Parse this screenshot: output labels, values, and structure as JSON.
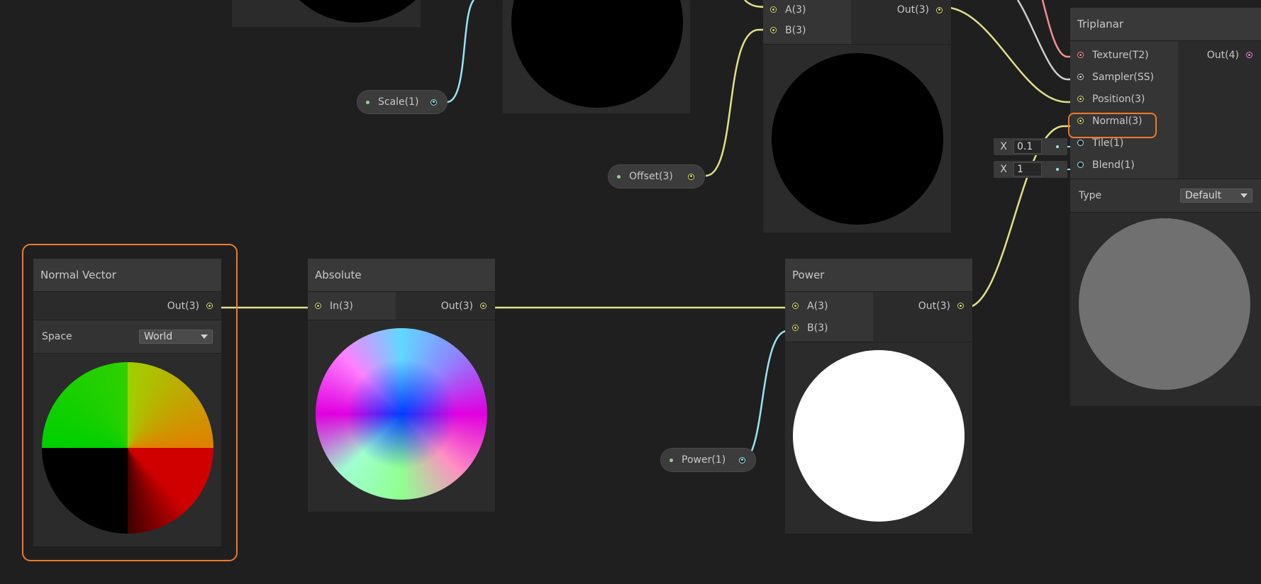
{
  "colors": {
    "wire_vector": "#d8d870",
    "wire_float": "#9ae3f2",
    "wire_texture": "#f09090",
    "wire_sampler": "#cfcfcf",
    "highlight": "#ee7a2b"
  },
  "nodes": {
    "normal_vector": {
      "title": "Normal Vector",
      "out": "Out(3)",
      "space_label": "Space",
      "space_value": "World"
    },
    "absolute": {
      "title": "Absolute",
      "in": "In(3)",
      "out": "Out(3)"
    },
    "power": {
      "title": "Power",
      "a": "A(3)",
      "b": "B(3)",
      "out": "Out(3)"
    },
    "add": {
      "a": "A(3)",
      "b": "B(3)",
      "out": "Out(3)"
    },
    "triplanar": {
      "title": "Triplanar",
      "texture": "Texture(T2)",
      "sampler": "Sampler(SS)",
      "position": "Position(3)",
      "normal": "Normal(3)",
      "tile": "Tile(1)",
      "blend": "Blend(1)",
      "out": "Out(4)",
      "type_label": "Type",
      "type_value": "Default"
    }
  },
  "properties": {
    "scale": "Scale(1)",
    "offset": "Offset(3)",
    "power": "Power(1)"
  },
  "inline_inputs": {
    "tile_axis": "X",
    "tile_value": "0.1",
    "blend_axis": "X",
    "blend_value": "1"
  }
}
